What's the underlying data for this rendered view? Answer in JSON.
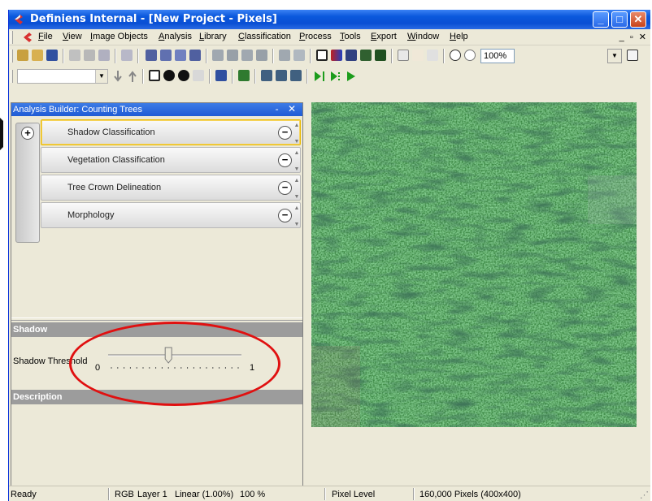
{
  "window": {
    "title": "Definiens Internal - [New Project - Pixels]",
    "controls": [
      "_",
      "□",
      "✕"
    ]
  },
  "menu": {
    "items": [
      {
        "label": "File",
        "u": "F",
        "rest": "ile"
      },
      {
        "label": "View",
        "u": "V",
        "rest": "iew"
      },
      {
        "label": "Image Objects",
        "u": "I",
        "rest": "mage Objects"
      },
      {
        "label": "Analysis",
        "u": "A",
        "rest": "nalysis"
      },
      {
        "label": "Library",
        "u": "L",
        "rest": "ibrary"
      },
      {
        "label": "Classification",
        "u": "C",
        "rest": "lassification"
      },
      {
        "label": "Process",
        "u": "P",
        "rest": "rocess"
      },
      {
        "label": "Tools",
        "u": "T",
        "rest": "ools"
      },
      {
        "label": "Export",
        "u": "E",
        "rest": "xport"
      },
      {
        "label": "Window",
        "u": "W",
        "rest": "indow"
      },
      {
        "label": "Help",
        "u": "H",
        "rest": "elp"
      }
    ],
    "mdi_controls": "_ ▫ ✕"
  },
  "toolbar": {
    "zoom_value": "100%",
    "zoom_arrow": "▼",
    "combo_arrow": "▼"
  },
  "panel": {
    "title": "Analysis Builder: Counting Trees",
    "title_controls": "- ✕",
    "add_symbol": "+",
    "steps": [
      {
        "label": "Shadow Classification",
        "selected": true
      },
      {
        "label": "Vegetation Classification",
        "selected": false
      },
      {
        "label": "Tree Crown Delineation",
        "selected": false
      },
      {
        "label": "Morphology",
        "selected": false
      }
    ],
    "remove_symbol": "−",
    "shadow_header": "Shadow",
    "threshold_label": "Shadow Threshold",
    "slider": {
      "min_label": "0",
      "max_label": "1",
      "value": 0.45
    },
    "description_header": "Description"
  },
  "status": {
    "ready": "Ready",
    "rgb": "RGB",
    "layer": "Layer 1",
    "stretch": "Linear (1.00%)",
    "zoom": "100 %",
    "level": "Pixel Level",
    "pixels": "160,000 Pixels  (400x400)"
  },
  "colors": {
    "title_blue": "#0a58dc",
    "annotation_red": "#e01010",
    "selection_yellow": "#e8b800"
  },
  "icons": [
    "app-icon",
    "open-icon",
    "save-icon",
    "pointer-icon",
    "hand-icon",
    "zoom-in-icon",
    "zoom-out-icon",
    "play-icon",
    "arrow-down-icon",
    "arrow-up-icon"
  ]
}
